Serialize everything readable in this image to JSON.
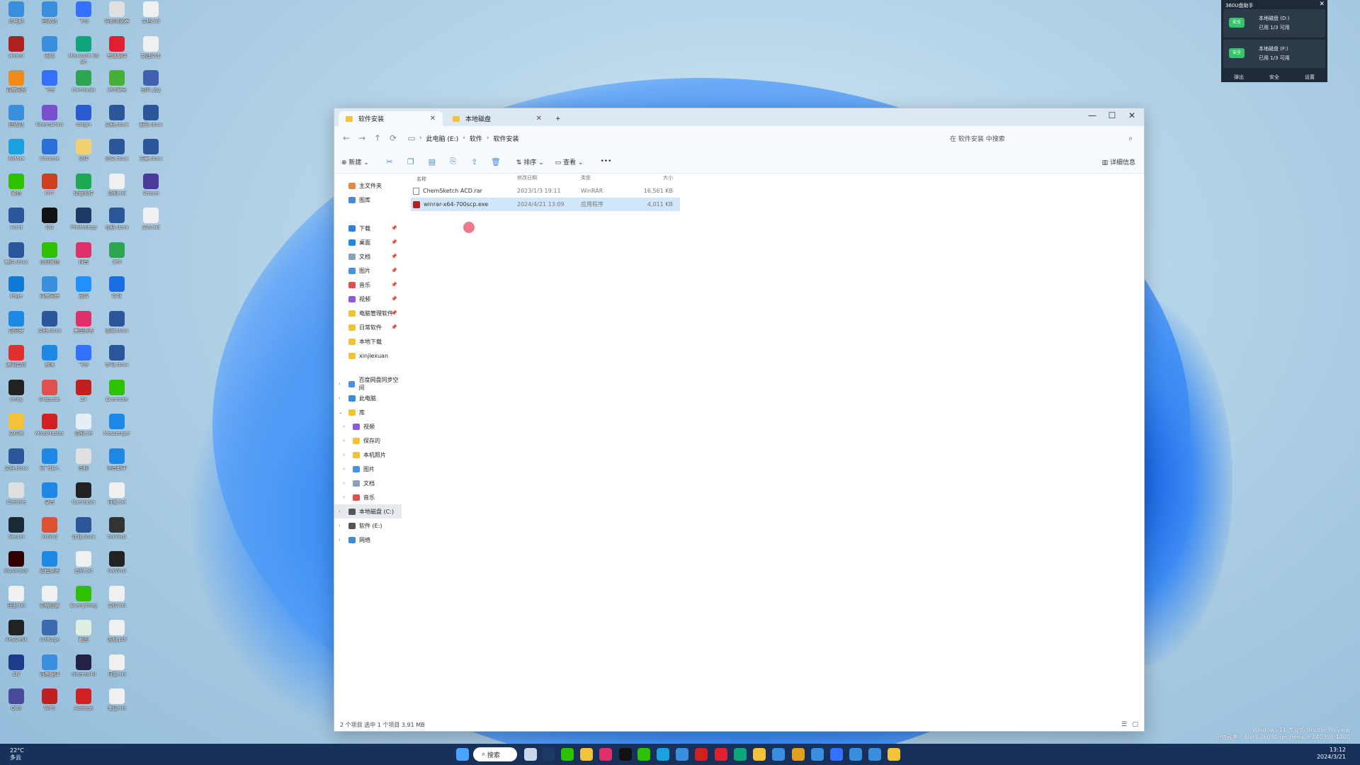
{
  "explorer": {
    "tabs": [
      {
        "label": "软件安装"
      },
      {
        "label": "本地磁盘"
      }
    ],
    "new_tab": "+",
    "window_controls": {
      "min": "—",
      "max": "☐",
      "close": "✕"
    },
    "address": {
      "crumbs": [
        "电脑",
        "此电脑 (E:)",
        "软件",
        "软件安装"
      ]
    },
    "search_placeholder": "在 软件安装 中搜索",
    "toolbar": {
      "new": "新建",
      "sort": "排序",
      "view": "查看",
      "more": "•••",
      "details": "详细信息"
    },
    "sidebar": {
      "quick": [
        {
          "label": "主文件夹",
          "color": "#e0884a"
        },
        {
          "label": "图库",
          "color": "#4a88d8"
        }
      ],
      "pinned": [
        {
          "label": "下载",
          "color": "#2d7fe0"
        },
        {
          "label": "桌面",
          "color": "#1e88e5"
        },
        {
          "label": "文档",
          "color": "#8aa0b8"
        },
        {
          "label": "图片",
          "color": "#4a90e2"
        },
        {
          "label": "音乐",
          "color": "#e05050"
        },
        {
          "label": "视频",
          "color": "#8b5cd6"
        },
        {
          "label": "电脑管理软件",
          "color": "#f2c23b"
        },
        {
          "label": "日常软件",
          "color": "#f2c23b"
        },
        {
          "label": "本地下载",
          "color": "#f2c23b"
        },
        {
          "label": "xinjiexuan",
          "color": "#f2c23b"
        }
      ],
      "tree": [
        {
          "label": "百度网盘同步空间",
          "color": "#4a90e2"
        },
        {
          "label": "此电脑",
          "color": "#3b8bd6"
        },
        {
          "label": "库",
          "color": "#f2c23b"
        },
        {
          "label": "视频",
          "color": "#8b5cd6"
        },
        {
          "label": "保存的",
          "color": "#f2c23b"
        },
        {
          "label": "本机照片",
          "color": "#f2c23b"
        },
        {
          "label": "图片",
          "color": "#4a90e2"
        },
        {
          "label": "文档",
          "color": "#8aa0b8"
        },
        {
          "label": "音乐",
          "color": "#e05050"
        },
        {
          "label": "本地磁盘 (C:)",
          "color": "#555555"
        },
        {
          "label": "软件 (E:)",
          "color": "#555555"
        },
        {
          "label": "网络",
          "color": "#3b8bd6"
        }
      ]
    },
    "columns": [
      "名称",
      "修改日期",
      "类型",
      "大小"
    ],
    "files": [
      {
        "name": "ChemSketch ACD.rar",
        "date": "2023/1/3 19:11",
        "type": "WinRAR",
        "size": "16,561 KB"
      },
      {
        "name": "winrar-x64-700scp.exe",
        "date": "2024/4/21 13:09",
        "type": "应用程序",
        "size": "4,011 KB"
      }
    ],
    "status": "2 个项目    选中 1 个项目  3.91 MB"
  },
  "widget": {
    "title": "360U盘助手",
    "cards": [
      {
        "badge": "安全",
        "line1": "本地磁盘 (D:)",
        "line2": "已用 1/3 可用"
      },
      {
        "badge": "安全",
        "line1": "本地磁盘 (F:)",
        "line2": "已用 1/3 可用"
      }
    ],
    "footer": [
      "弹出",
      "安全",
      "设置"
    ]
  },
  "desktop_icons": [
    {
      "label": "此电脑",
      "color": "#3a8ee0"
    },
    {
      "label": "回收站",
      "color": "#3a8ee0"
    },
    {
      "label": "飞书",
      "color": "#3370ff"
    },
    {
      "label": "谷歌浏览器",
      "color": "#e0e0e0"
    },
    {
      "label": "文档.txt",
      "color": "#f0f0f0"
    },
    {
      "label": "winrar",
      "color": "#b02020"
    },
    {
      "label": "网络",
      "color": "#3a8ee0"
    },
    {
      "label": "Microsoft Edge",
      "color": "#0fa57a"
    },
    {
      "label": "有道翻译",
      "color": "#e02030"
    },
    {
      "label": "新建文本",
      "color": "#f0f0f0"
    },
    {
      "label": "百度网盘",
      "color": "#f28a1b"
    },
    {
      "label": "飞书",
      "color": "#3370ff"
    },
    {
      "label": "Camtasia",
      "color": "#2da44e"
    },
    {
      "label": "360安全",
      "color": "#45b035"
    },
    {
      "label": "图片.jpg",
      "color": "#4060b0"
    },
    {
      "label": "回收站",
      "color": "#3a8ee0"
    },
    {
      "label": "ChemDraw",
      "color": "#7a4fd0"
    },
    {
      "label": "Origin",
      "color": "#2a5ad0"
    },
    {
      "label": "文档.docx",
      "color": "#2b579a"
    },
    {
      "label": "报告.docx",
      "color": "#2b579a"
    },
    {
      "label": "3dMax",
      "color": "#1ba0e0"
    },
    {
      "label": "Chrome",
      "color": "#2a70d8"
    },
    {
      "label": "文件",
      "color": "#f0d070"
    },
    {
      "label": "论文.docx",
      "color": "#2b579a"
    },
    {
      "label": "方案.docx",
      "color": "#2b579a"
    },
    {
      "label": "微信",
      "color": "#2dc100"
    },
    {
      "label": "PPT",
      "color": "#d04020"
    },
    {
      "label": "绿色软件",
      "color": "#1da851"
    },
    {
      "label": "说明.txt",
      "color": "#f0f0f0"
    },
    {
      "label": "Steam",
      "color": "#4a3a9a"
    },
    {
      "label": "word",
      "color": "#2b579a"
    },
    {
      "label": "QQ",
      "color": "#111111"
    },
    {
      "label": "Photoshop",
      "color": "#1d3a66"
    },
    {
      "label": "总结.docx",
      "color": "#2b579a"
    },
    {
      "label": "文本.txt",
      "color": "#f0f0f0"
    },
    {
      "label": "稿件.docx",
      "color": "#2b579a"
    },
    {
      "label": "企业微信",
      "color": "#2dc100"
    },
    {
      "label": "抖音",
      "color": "#e0306a"
    },
    {
      "label": "360",
      "color": "#2da44e"
    },
    {
      "label": "",
      "color": "rgba(0,0,0,0)"
    },
    {
      "label": "Edge",
      "color": "#0f7ad8"
    },
    {
      "label": "百度网盘",
      "color": "#3a8ee0"
    },
    {
      "label": "迅雷",
      "color": "#1e90ff"
    },
    {
      "label": "钉钉",
      "color": "#1b6ee0"
    },
    {
      "label": "",
      "color": "rgba(0,0,0,0)"
    },
    {
      "label": "向日葵",
      "color": "#1e88e5"
    },
    {
      "label": "文档.docx",
      "color": "#2b579a"
    },
    {
      "label": "美图秀秀",
      "color": "#e0306a"
    },
    {
      "label": "说明.docx",
      "color": "#2b579a"
    },
    {
      "label": "",
      "color": "rgba(0,0,0,0)"
    },
    {
      "label": "腾讯会议",
      "color": "#e03030"
    },
    {
      "label": "剪映",
      "color": "#1e88e5"
    },
    {
      "label": "飞书",
      "color": "#3370ff"
    },
    {
      "label": "学习.docx",
      "color": "#2b579a"
    },
    {
      "label": "",
      "color": "rgba(0,0,0,0)"
    },
    {
      "label": "Unity",
      "color": "#222222"
    },
    {
      "label": "Snipaste",
      "color": "#e05050"
    },
    {
      "label": "ZY",
      "color": "#c02020"
    },
    {
      "label": "Evernote",
      "color": "#2dc100"
    },
    {
      "label": "",
      "color": "rgba(0,0,0,0)"
    },
    {
      "label": "文件夹",
      "color": "#f2c23b"
    },
    {
      "label": "MindMaster",
      "color": "#d02020"
    },
    {
      "label": "说明.txt",
      "color": "#e8eef5"
    },
    {
      "label": "Messenger",
      "color": "#1e88e5"
    },
    {
      "label": "",
      "color": "rgba(0,0,0,0)"
    },
    {
      "label": "文档.docx",
      "color": "#2b579a"
    },
    {
      "label": "讯飞输入",
      "color": "#1e88e5"
    },
    {
      "label": "图标",
      "color": "#e0e0e0"
    },
    {
      "label": "语音助手",
      "color": "#1e88e5"
    },
    {
      "label": "",
      "color": "rgba(0,0,0,0)"
    },
    {
      "label": "Chrome",
      "color": "#e0e0e0"
    },
    {
      "label": "录音",
      "color": "#1e88e5"
    },
    {
      "label": "Camtasia",
      "color": "#222222"
    },
    {
      "label": "日志.txt",
      "color": "#f0f0f0"
    },
    {
      "label": "",
      "color": "rgba(0,0,0,0)"
    },
    {
      "label": "Steam",
      "color": "#1b2838"
    },
    {
      "label": "Xmind",
      "color": "#e05030"
    },
    {
      "label": "计划.docx",
      "color": "#2b579a"
    },
    {
      "label": "DaVinci",
      "color": "#333333"
    },
    {
      "label": "",
      "color": "rgba(0,0,0,0)"
    },
    {
      "label": "Illustrator",
      "color": "#330000"
    },
    {
      "label": "远程桌面",
      "color": "#1e88e5"
    },
    {
      "label": "备忘.txt",
      "color": "#f0f0f0"
    },
    {
      "label": "DaVinci",
      "color": "#222222"
    },
    {
      "label": "",
      "color": "rgba(0,0,0,0)"
    },
    {
      "label": "日志.txt",
      "color": "#f0f0f0"
    },
    {
      "label": "系统设置",
      "color": "#f0f0f0"
    },
    {
      "label": "Everything",
      "color": "#2dc100"
    },
    {
      "label": "文件.txt",
      "color": "#f0f0f0"
    },
    {
      "label": "",
      "color": "rgba(0,0,0,0)"
    },
    {
      "label": "AnyDesk",
      "color": "#222222"
    },
    {
      "label": "ArtRage",
      "color": "#3a6ab0"
    },
    {
      "label": "截图",
      "color": "#e0f0e0"
    },
    {
      "label": "说明.pdf",
      "color": "#f0f0f0"
    },
    {
      "label": "",
      "color": "rgba(0,0,0,0)"
    },
    {
      "label": "EN",
      "color": "#1e3a8a"
    },
    {
      "label": "百度翻译",
      "color": "#3a8ee0"
    },
    {
      "label": "cinema4d",
      "color": "#222244"
    },
    {
      "label": "日志.txt",
      "color": "#f0f0f0"
    },
    {
      "label": "",
      "color": "rgba(0,0,0,0)"
    },
    {
      "label": "OBS",
      "color": "#4a4a9a"
    },
    {
      "label": "WPS",
      "color": "#c02020"
    },
    {
      "label": "Acrobat",
      "color": "#d02020"
    },
    {
      "label": "笔记.txt",
      "color": "#f0f0f0"
    },
    {
      "label": "",
      "color": "rgba(0,0,0,0)"
    }
  ],
  "taskbar": {
    "weather_temp": "22°C",
    "weather_desc": "多云",
    "search_label": "搜索",
    "apps": [
      {
        "name": "start-icon",
        "color": "#4aa3ff"
      },
      {
        "name": "task-view-icon",
        "color": "#c8d8ec"
      },
      {
        "name": "photoshop-icon",
        "color": "#1d3a66"
      },
      {
        "name": "wechat-icon",
        "color": "#2dc100"
      },
      {
        "name": "explorer-icon",
        "color": "#f2c23b"
      },
      {
        "name": "app-icon",
        "color": "#e0306a"
      },
      {
        "name": "qq-icon",
        "color": "#111111"
      },
      {
        "name": "wechat2-icon",
        "color": "#2dc100"
      },
      {
        "name": "calc-icon",
        "color": "#1ba0e0"
      },
      {
        "name": "clock-icon",
        "color": "#3a8ee0"
      },
      {
        "name": "app2-icon",
        "color": "#d02020"
      },
      {
        "name": "youdao-icon",
        "color": "#e02030"
      },
      {
        "name": "edge-icon",
        "color": "#0fa57a"
      },
      {
        "name": "notes-icon",
        "color": "#f2c23b"
      },
      {
        "name": "app3-icon",
        "color": "#3a8ee0"
      },
      {
        "name": "chrome-icon",
        "color": "#e0a020"
      },
      {
        "name": "app4-icon",
        "color": "#3a8ee0"
      },
      {
        "name": "feishu-icon",
        "color": "#3370ff"
      },
      {
        "name": "app5-icon",
        "color": "#3a8ee0"
      },
      {
        "name": "app6-icon",
        "color": "#3a8ee0"
      },
      {
        "name": "app7-icon",
        "color": "#f2c23b"
      }
    ],
    "time": "13:12",
    "date": "2024/3/21"
  },
  "watermark": {
    "line1": "Windows 11 专业版 Insider Preview",
    "line2": "评估副本。Build 26080.ge_release.240308-1400"
  }
}
